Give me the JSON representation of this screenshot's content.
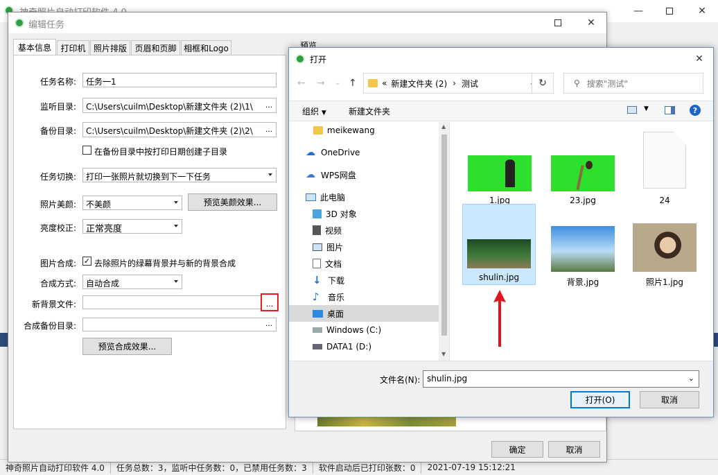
{
  "main_window": {
    "title": "神奇照片自动打印软件 4.0"
  },
  "status_bar": {
    "items": [
      "神奇照片自动打印软件 4.0",
      "任务总数：3，监听中任务数：0，已禁用任务数：3",
      "软件启动后已打印张数：0",
      "2021-07-19 15:12:21"
    ]
  },
  "edit_dialog": {
    "title": "编辑任务",
    "preview_label": "预览",
    "tabs": [
      "基本信息",
      "打印机",
      "照片排版",
      "页眉和页脚",
      "相框和Logo"
    ],
    "task_name": {
      "label": "任务名称:",
      "value": "任务一1"
    },
    "watch_dir": {
      "label": "监听目录:",
      "value": "C:\\Users\\cuilm\\Desktop\\新建文件夹 (2)\\1\\"
    },
    "backup_dir": {
      "label": "备份目录:",
      "value": "C:\\Users\\cuilm\\Desktop\\新建文件夹 (2)\\2\\"
    },
    "date_subdir": {
      "label": "在备份目录中按打印日期创建子目录",
      "checked": false
    },
    "task_switch": {
      "label": "任务切换:",
      "value": "打印一张照片就切换到下一下任务"
    },
    "beauty": {
      "label": "照片美颜:",
      "value": "不美颜",
      "preview_button": "预览美颜效果..."
    },
    "brightness": {
      "label": "亮度校正:",
      "value": "正常亮度"
    },
    "compose": {
      "label": "图片合成:",
      "checkbox_label": "去除照片的绿幕背景并与新的背景合成",
      "checked": true
    },
    "compose_mode": {
      "label": "合成方式:",
      "value": "自动合成"
    },
    "new_bg_file": {
      "label": "新背景文件:",
      "value": ""
    },
    "compose_backup_dir": {
      "label": "合成备份目录:",
      "value": ""
    },
    "preview_compose_button": "预览合成效果...",
    "browse_label": "...",
    "ok_button": "确定",
    "cancel_button": "取消"
  },
  "open_dialog": {
    "title": "打开",
    "breadcrumb": [
      "«",
      "新建文件夹 (2)",
      "测试"
    ],
    "search_placeholder": "搜索\"测试\"",
    "toolbar": {
      "organize": "组织",
      "new_folder": "新建文件夹"
    },
    "nav_items": [
      {
        "label": "meikewang",
        "icon": "folder-icon"
      },
      {
        "label": "OneDrive",
        "icon": "cloud-icon"
      },
      {
        "label": "WPS网盘",
        "icon": "wps-cloud-icon"
      },
      {
        "label": "此电脑",
        "icon": "computer-icon"
      },
      {
        "label": "3D 对象",
        "icon": "cube-icon"
      },
      {
        "label": "视频",
        "icon": "video-icon"
      },
      {
        "label": "图片",
        "icon": "picture-icon"
      },
      {
        "label": "文档",
        "icon": "document-icon"
      },
      {
        "label": "下载",
        "icon": "download-icon"
      },
      {
        "label": "音乐",
        "icon": "music-icon"
      },
      {
        "label": "桌面",
        "icon": "desktop-icon"
      },
      {
        "label": "Windows (C:)",
        "icon": "drive-icon"
      },
      {
        "label": "DATA1 (D:)",
        "icon": "drive-icon"
      }
    ],
    "files": [
      {
        "name": "1.jpg"
      },
      {
        "name": "23.jpg"
      },
      {
        "name": "24"
      },
      {
        "name": "shulin.jpg",
        "selected": true
      },
      {
        "name": "背景.jpg"
      },
      {
        "name": "照片1.jpg"
      }
    ],
    "filename": {
      "label": "文件名(N):",
      "value": "shulin.jpg"
    },
    "open_button": "打开(O)",
    "cancel_button": "取消"
  }
}
